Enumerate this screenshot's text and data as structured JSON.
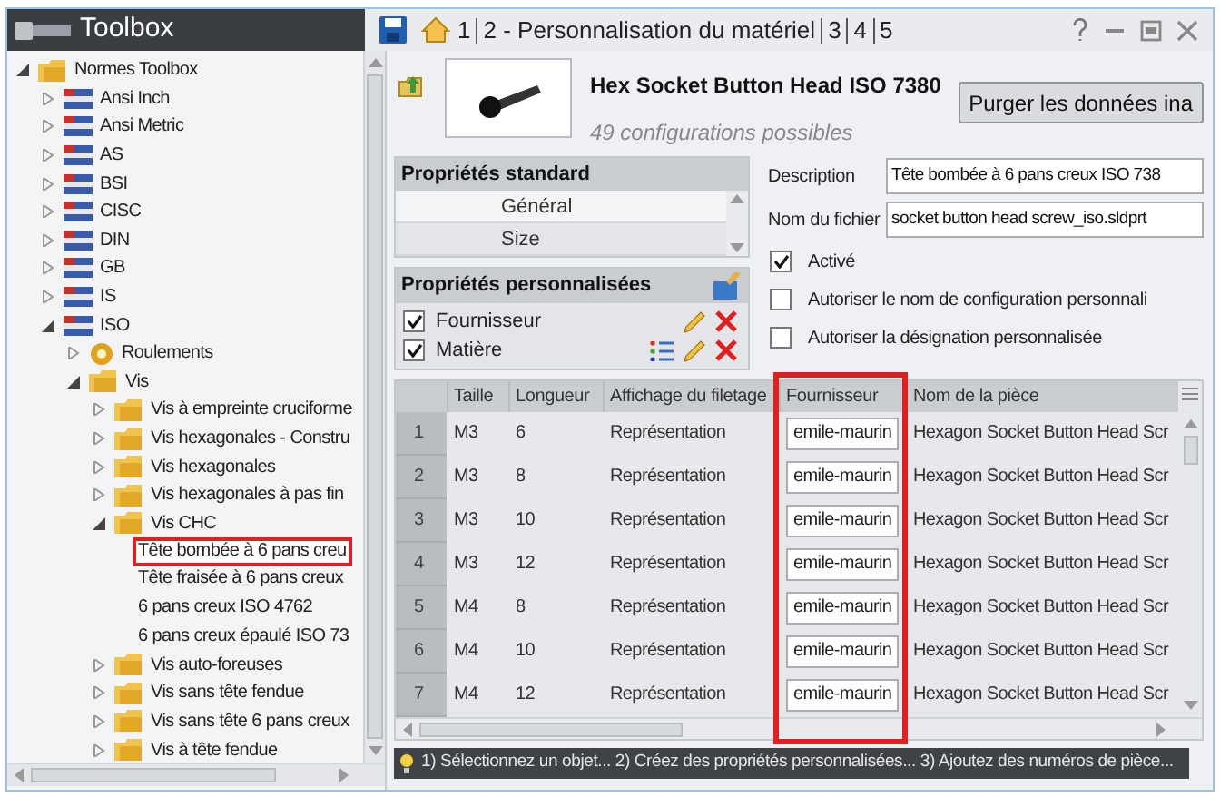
{
  "window": {
    "title": "Toolbox",
    "tabs": [
      {
        "label": "1"
      },
      {
        "label": "2 - Personnalisation du matériel"
      },
      {
        "label": "3"
      },
      {
        "label": "4"
      },
      {
        "label": "5"
      }
    ]
  },
  "tree": [
    {
      "label": "Normes Toolbox",
      "kind": "folder",
      "expanded": true,
      "children": [
        {
          "label": "Ansi Inch",
          "kind": "flag",
          "expanded": false
        },
        {
          "label": "Ansi Metric",
          "kind": "flag",
          "expanded": false
        },
        {
          "label": "AS",
          "kind": "flag",
          "expanded": false
        },
        {
          "label": "BSI",
          "kind": "flag",
          "expanded": false
        },
        {
          "label": "CISC",
          "kind": "flag",
          "expanded": false
        },
        {
          "label": "DIN",
          "kind": "flag",
          "expanded": false
        },
        {
          "label": "GB",
          "kind": "flag",
          "expanded": false
        },
        {
          "label": "IS",
          "kind": "flag",
          "expanded": false
        },
        {
          "label": "ISO",
          "kind": "flag",
          "expanded": true,
          "children": [
            {
              "label": "Roulements",
              "kind": "gear",
              "expanded": false
            },
            {
              "label": "Vis",
              "kind": "folder",
              "expanded": true,
              "children": [
                {
                  "label": "Vis à empreinte cruciforme",
                  "kind": "folder",
                  "expanded": false
                },
                {
                  "label": "Vis hexagonales - Constru",
                  "kind": "folder",
                  "expanded": false
                },
                {
                  "label": "Vis hexagonales",
                  "kind": "folder",
                  "expanded": false
                },
                {
                  "label": "Vis hexagonales à pas fin",
                  "kind": "folder",
                  "expanded": false
                },
                {
                  "label": "Vis CHC",
                  "kind": "folder",
                  "expanded": true,
                  "children": [
                    {
                      "label": "Tête bombée à 6 pans creu",
                      "kind": "leaf",
                      "selected": true
                    },
                    {
                      "label": "Tête fraisée à 6 pans creux",
                      "kind": "leaf",
                      "selected": false
                    },
                    {
                      "label": "6 pans creux ISO 4762",
                      "kind": "leaf",
                      "selected": false
                    },
                    {
                      "label": "6 pans creux épaulé ISO 73",
                      "kind": "leaf",
                      "selected": false
                    }
                  ]
                },
                {
                  "label": "Vis auto-foreuses",
                  "kind": "folder",
                  "expanded": false
                },
                {
                  "label": "Vis sans tête fendue",
                  "kind": "folder",
                  "expanded": false
                },
                {
                  "label": "Vis sans tête 6 pans creux",
                  "kind": "folder",
                  "expanded": false
                },
                {
                  "label": "Vis à tête fendue",
                  "kind": "folder",
                  "expanded": false
                }
              ]
            }
          ]
        }
      ]
    }
  ],
  "part": {
    "title": "Hex Socket Button Head ISO 7380",
    "subtitle": "49 configurations possibles",
    "button": "Purger les données ina"
  },
  "standard_properties": {
    "title": "Propriétés standard",
    "items": [
      {
        "label": "Général",
        "selected": true
      },
      {
        "label": "Size",
        "selected": false
      }
    ]
  },
  "custom_properties": {
    "title": "Propriétés personnalisées",
    "items": [
      {
        "label": "Fournisseur",
        "checked": true,
        "list_icon": false
      },
      {
        "label": "Matière",
        "checked": true,
        "list_icon": true
      }
    ]
  },
  "form": {
    "fields": [
      {
        "label": "Description",
        "value": "Tête bombée à 6 pans creux ISO 738"
      },
      {
        "label": "Nom du fichier",
        "value": "socket button head screw_iso.sldprt"
      }
    ],
    "options": [
      {
        "label": "Activé",
        "checked": true
      },
      {
        "label": "Autoriser le nom de configuration personnali",
        "checked": false
      },
      {
        "label": "Autoriser la désignation personnalisée",
        "checked": false
      }
    ]
  },
  "table": {
    "columns": [
      "Taille",
      "Longueur",
      "Affichage du filetage",
      "Fournisseur",
      "Nom de la pièce"
    ],
    "rows": [
      {
        "number": "1",
        "cells": [
          "M3",
          "6",
          "Représentation",
          "emile-maurin",
          "Hexagon Socket Button Head Scr"
        ]
      },
      {
        "number": "2",
        "cells": [
          "M3",
          "8",
          "Représentation",
          "emile-maurin",
          "Hexagon Socket Button Head Scr"
        ]
      },
      {
        "number": "3",
        "cells": [
          "M3",
          "10",
          "Représentation",
          "emile-maurin",
          "Hexagon Socket Button Head Scr"
        ]
      },
      {
        "number": "4",
        "cells": [
          "M3",
          "12",
          "Représentation",
          "emile-maurin",
          "Hexagon Socket Button Head Scr"
        ]
      },
      {
        "number": "5",
        "cells": [
          "M4",
          "8",
          "Représentation",
          "emile-maurin",
          "Hexagon Socket Button Head Scr"
        ]
      },
      {
        "number": "6",
        "cells": [
          "M4",
          "10",
          "Représentation",
          "emile-maurin",
          "Hexagon Socket Button Head Scr"
        ]
      },
      {
        "number": "7",
        "cells": [
          "M4",
          "12",
          "Représentation",
          "emile-maurin",
          "Hexagon Socket Button Head Scr"
        ]
      }
    ]
  },
  "status_bar": "1) Sélectionnez un objet... 2) Créez des propriétés personnalisées... 3) Ajoutez des numéros de pièce..."
}
